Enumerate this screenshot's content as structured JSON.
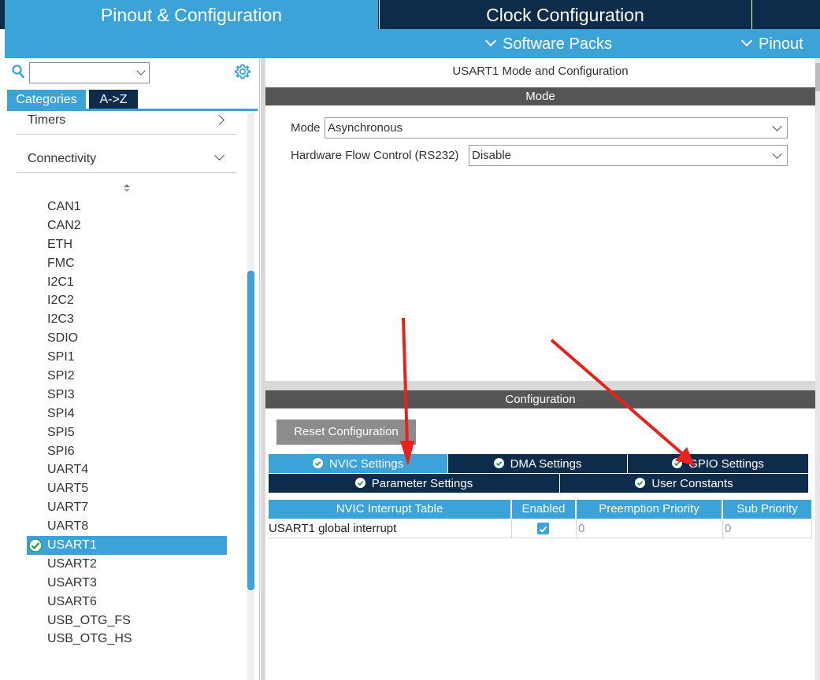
{
  "top_tabs": {
    "pinout": "Pinout & Configuration",
    "clock": "Clock Configuration"
  },
  "sub_bar": {
    "software_packs": "Software Packs",
    "pinout": "Pinout"
  },
  "left": {
    "search_placeholder": "",
    "tabs": [
      "Categories",
      "A->Z"
    ],
    "categories": [
      {
        "label": "Timers",
        "state": "collapsed"
      },
      {
        "label": "Connectivity",
        "state": "expanded"
      }
    ],
    "peripherals": [
      "CAN1",
      "CAN2",
      "ETH",
      "FMC",
      "I2C1",
      "I2C2",
      "I2C3",
      "SDIO",
      "SPI1",
      "SPI2",
      "SPI3",
      "SPI4",
      "SPI5",
      "SPI6",
      "UART4",
      "UART5",
      "UART7",
      "UART8",
      "USART1",
      "USART2",
      "USART3",
      "USART6",
      "USB_OTG_FS",
      "USB_OTG_HS"
    ],
    "selected": "USART1"
  },
  "mode_panel": {
    "title": "USART1 Mode and Configuration",
    "section": "Mode",
    "mode_label": "Mode",
    "mode_value": "Asynchronous",
    "flow_label": "Hardware Flow Control (RS232)",
    "flow_value": "Disable"
  },
  "config_panel": {
    "section": "Configuration",
    "reset_label": "Reset Configuration",
    "tabs_row1": [
      "NVIC Settings",
      "DMA Settings",
      "GPIO Settings"
    ],
    "tabs_row2": [
      "Parameter Settings",
      "User Constants"
    ],
    "active_tab": "NVIC Settings",
    "table": {
      "headers": [
        "NVIC Interrupt Table",
        "Enabled",
        "Preemption Priority",
        "Sub Priority"
      ],
      "rows": [
        {
          "name": "USART1 global interrupt",
          "enabled": true,
          "preemption": "0",
          "sub": "0"
        }
      ]
    }
  },
  "colors": {
    "accent": "#3ca3d9",
    "dark_navy": "#0d2b4a",
    "section_gray": "#555555",
    "annotation_red": "#e8211b"
  }
}
